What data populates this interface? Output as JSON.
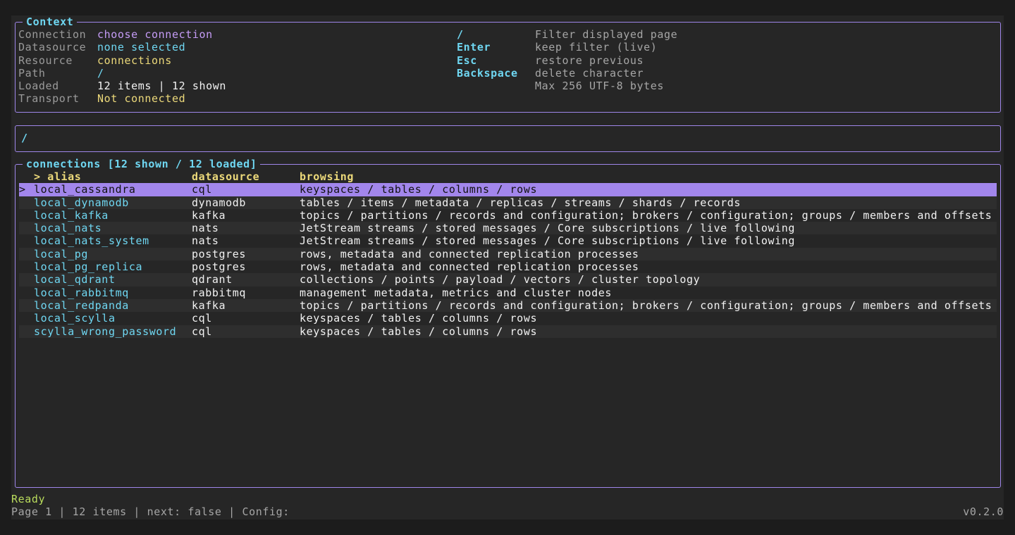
{
  "context": {
    "title": "Context",
    "fields": [
      {
        "label": "Connection",
        "value": "choose connection",
        "color": "#c59cf6"
      },
      {
        "label": "Datasource",
        "value": "none selected",
        "color": "#6fd7f2"
      },
      {
        "label": "Resource",
        "value": "connections",
        "color": "#ecd97a"
      },
      {
        "label": "Path",
        "value": "/",
        "color": "#6fd7f2"
      },
      {
        "label": "Loaded",
        "value": "12 items | 12 shown",
        "color": "#f2f2f2"
      },
      {
        "label": "Transport",
        "value": "Not connected",
        "color": "#ecd97a"
      }
    ],
    "help": [
      {
        "key": "/",
        "desc": "Filter displayed page"
      },
      {
        "key": "Enter",
        "desc": "keep filter (live)"
      },
      {
        "key": "Esc",
        "desc": "restore previous"
      },
      {
        "key": "Backspace",
        "desc": "delete character"
      },
      {
        "key": "",
        "desc": "Max 256 UTF-8 bytes"
      }
    ]
  },
  "filter": {
    "text": "/"
  },
  "list": {
    "title": "connections [12 shown / 12 loaded]",
    "columns": {
      "alias": "> alias",
      "datasource": "datasource",
      "browsing": "browsing"
    },
    "selected_marker": ">",
    "selected_index": 0,
    "rows": [
      {
        "alias": "local_cassandra",
        "datasource": "cql",
        "browsing": "keyspaces / tables / columns / rows"
      },
      {
        "alias": "local_dynamodb",
        "datasource": "dynamodb",
        "browsing": "tables / items / metadata / replicas / streams / shards / records"
      },
      {
        "alias": "local_kafka",
        "datasource": "kafka",
        "browsing": "topics / partitions / records and configuration; brokers / configuration; groups / members and offsets"
      },
      {
        "alias": "local_nats",
        "datasource": "nats",
        "browsing": "JetStream streams / stored messages / Core subscriptions / live following"
      },
      {
        "alias": "local_nats_system",
        "datasource": "nats",
        "browsing": "JetStream streams / stored messages / Core subscriptions / live following"
      },
      {
        "alias": "local_pg",
        "datasource": "postgres",
        "browsing": "rows, metadata and connected replication processes"
      },
      {
        "alias": "local_pg_replica",
        "datasource": "postgres",
        "browsing": "rows, metadata and connected replication processes"
      },
      {
        "alias": "local_qdrant",
        "datasource": "qdrant",
        "browsing": "collections / points / payload / vectors / cluster topology"
      },
      {
        "alias": "local_rabbitmq",
        "datasource": "rabbitmq",
        "browsing": "management metadata, metrics and cluster nodes"
      },
      {
        "alias": "local_redpanda",
        "datasource": "kafka",
        "browsing": "topics / partitions / records and configuration; brokers / configuration; groups / members and offsets"
      },
      {
        "alias": "local_scylla",
        "datasource": "cql",
        "browsing": "keyspaces / tables / columns / rows"
      },
      {
        "alias": "scylla_wrong_password",
        "datasource": "cql",
        "browsing": "keyspaces / tables / columns / rows"
      }
    ]
  },
  "status": {
    "message": "Ready",
    "footer": "Page 1 | 12 items | next: false | Config:",
    "version": "v0.2.0"
  },
  "colors": {
    "border": "#9f86ea",
    "selection": "#a286ec",
    "accent_cyan": "#6fd7f2",
    "accent_yellow": "#ecd97a",
    "ready_green": "#b9dc5c"
  }
}
